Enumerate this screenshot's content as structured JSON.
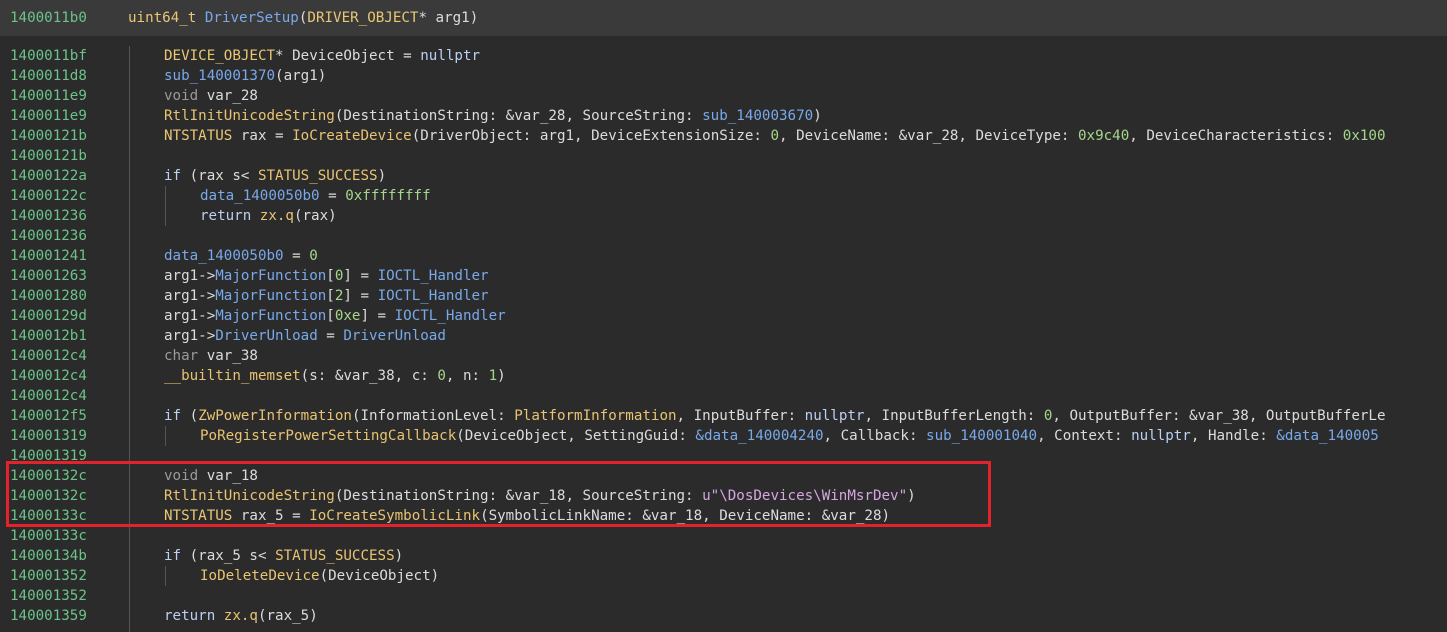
{
  "header": {
    "address": "1400011b0",
    "signature_return_type": "uint64_t",
    "signature_function": "DriverSetup",
    "signature_param_type": "DRIVER_OBJECT",
    "signature_rest": "* arg1)"
  },
  "lines": [
    {
      "addr": "1400011bf",
      "text": "DEVICE_OBJECT* DeviceObject = nullptr"
    },
    {
      "addr": "1400011d8",
      "text": "sub_140001370(arg1)"
    },
    {
      "addr": "1400011e9",
      "text": "void var_28"
    },
    {
      "addr": "1400011e9",
      "text": "RtlInitUnicodeString(DestinationString: &var_28, SourceString: sub_140003670)"
    },
    {
      "addr": "14000121b",
      "text": "NTSTATUS rax = IoCreateDevice(DriverObject: arg1, DeviceExtensionSize: 0, DeviceName: &var_28, DeviceType: 0x9c40, DeviceCharacteristics: 0x100"
    },
    {
      "addr": "14000121b",
      "text": ""
    },
    {
      "addr": "14000122a",
      "text": "if (rax s< STATUS_SUCCESS)"
    },
    {
      "addr": "14000122c",
      "text": "data_1400050b0 = 0xffffffff"
    },
    {
      "addr": "140001236",
      "text": "return zx.q(rax)"
    },
    {
      "addr": "140001236",
      "text": ""
    },
    {
      "addr": "140001241",
      "text": "data_1400050b0 = 0"
    },
    {
      "addr": "140001263",
      "text": "arg1->MajorFunction[0] = IOCTL_Handler"
    },
    {
      "addr": "140001280",
      "text": "arg1->MajorFunction[2] = IOCTL_Handler"
    },
    {
      "addr": "14000129d",
      "text": "arg1->MajorFunction[0xe] = IOCTL_Handler"
    },
    {
      "addr": "1400012b1",
      "text": "arg1->DriverUnload = DriverUnload"
    },
    {
      "addr": "1400012c4",
      "text": "char var_38"
    },
    {
      "addr": "1400012c4",
      "text": "__builtin_memset(s: &var_38, c: 0, n: 1)"
    },
    {
      "addr": "1400012c4",
      "text": ""
    },
    {
      "addr": "1400012f5",
      "text": "if (ZwPowerInformation(InformationLevel: PlatformInformation, InputBuffer: nullptr, InputBufferLength: 0, OutputBuffer: &var_38, OutputBufferLe"
    },
    {
      "addr": "140001319",
      "text": "PoRegisterPowerSettingCallback(DeviceObject, SettingGuid: &data_140004240, Callback: sub_140001040, Context: nullptr, Handle: &data_140005"
    },
    {
      "addr": "140001319",
      "text": ""
    },
    {
      "addr": "14000132c",
      "text": "void var_18"
    },
    {
      "addr": "14000132c",
      "text": "RtlInitUnicodeString(DestinationString: &var_18, SourceString: u\"\\DosDevices\\WinMsrDev\")"
    },
    {
      "addr": "14000133c",
      "text": "NTSTATUS rax_5 = IoCreateSymbolicLink(SymbolicLinkName: &var_18, DeviceName: &var_28)"
    },
    {
      "addr": "14000133c",
      "text": ""
    },
    {
      "addr": "14000134b",
      "text": "if (rax_5 s< STATUS_SUCCESS)"
    },
    {
      "addr": "140001352",
      "text": "IoDeleteDevice(DeviceObject)"
    },
    {
      "addr": "140001352",
      "text": ""
    },
    {
      "addr": "140001359",
      "text": "return zx.q(rax_5)"
    }
  ],
  "colors": {
    "background": "#2b2b2b",
    "header_background": "#3a3a3a",
    "address": "#6cc38a",
    "highlight_border": "#e3222b"
  }
}
